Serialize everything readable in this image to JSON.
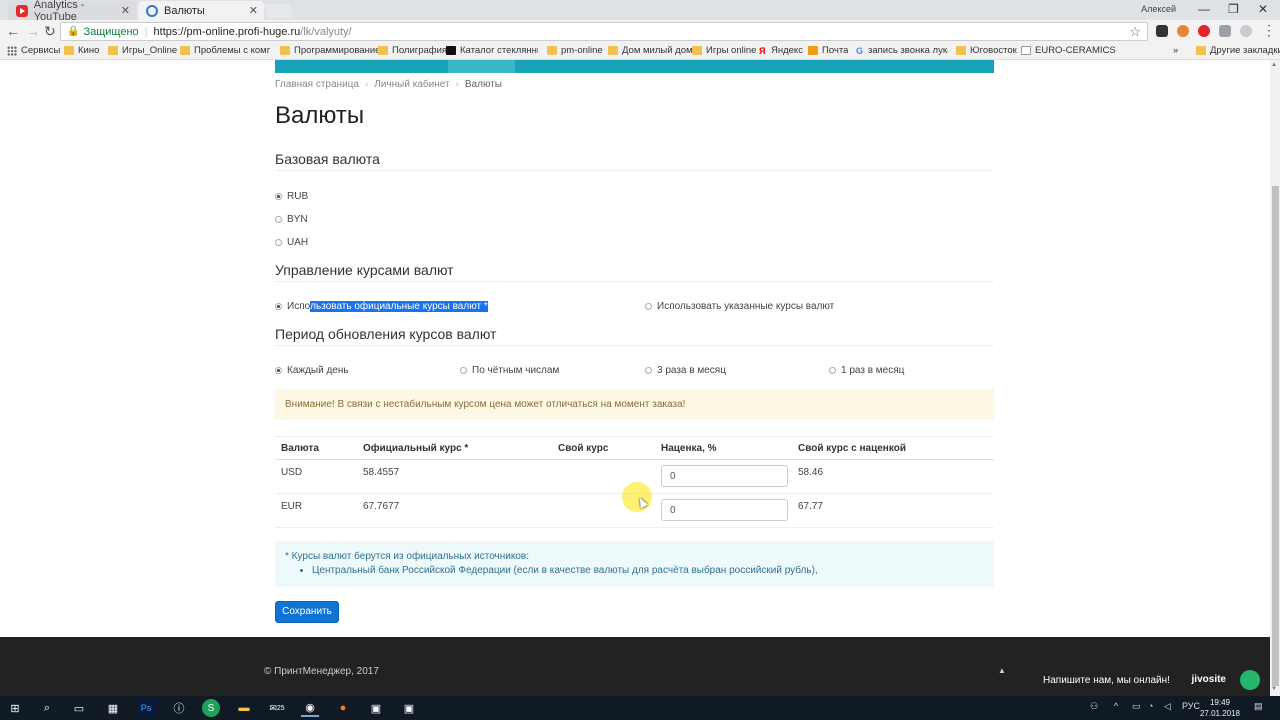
{
  "browser": {
    "tabs": [
      {
        "title": "Analytics - YouTube",
        "icon": "youtube-icon"
      },
      {
        "title": "Валюты",
        "icon": "globe-icon"
      }
    ],
    "user": "Алексей",
    "secure_label": "Защищено",
    "url_host": "https://pm-online.profi-huge.ru",
    "url_path": "/lk/valyuty/",
    "bookmarks": [
      "Сервисы",
      "Кино",
      "Игры_Online",
      "Проблемы с компо",
      "Программирование",
      "Полиграфия",
      "Каталог стеклянных",
      "pm-online",
      "Дом милый дом",
      "Игры online",
      "Яндекс",
      "Почта",
      "запись звонка лука",
      "Юговосток",
      "EURO-CERAMICS"
    ],
    "other_bookmarks": "Другие закладки",
    "more": "»"
  },
  "page": {
    "breadcrumb": [
      "Главная страница",
      "Личный кабинет",
      "Валюты"
    ],
    "title": "Валюты",
    "base_currency": {
      "title": "Базовая валюта",
      "options": [
        "RUB",
        "BYN",
        "UAH"
      ],
      "selected": "RUB"
    },
    "rates_management": {
      "title": "Управление курсами валют",
      "option_official_prefix": "Испо",
      "option_official_selected": "льзовать официальные курсы валют *",
      "option_custom": "Использовать указанные курсы валют"
    },
    "update_period": {
      "title": "Период обновления курсов валют",
      "options": [
        "Каждый день",
        "По чётным числам",
        "3 раза в месяц",
        "1 раз в месяц"
      ],
      "selected": "Каждый день"
    },
    "warning": "Внимание! В связи с нестабильным курсом цена может отличаться на момент заказа!",
    "table": {
      "headers": [
        "Валюта",
        "Официальный курс *",
        "Свой курс",
        "Наценка, %",
        "Свой курс с наценкой"
      ],
      "rows": [
        {
          "currency": "USD",
          "official": "58.4557",
          "custom": "",
          "markup": "0",
          "custom_with_markup": "58.46"
        },
        {
          "currency": "EUR",
          "official": "67.7677",
          "custom": "",
          "markup": "0",
          "custom_with_markup": "67.77"
        }
      ]
    },
    "info": {
      "note": "* Курсы валют берутся из официальных источников:",
      "sources": [
        "Центральный банк Российской Федерации (если в качестве валюты для расчёта выбран российский рубль),"
      ]
    },
    "save_label": "Сохранить",
    "footer": "© ПринтМенеджер, 2017",
    "chat": {
      "label": "Напишите нам, мы онлайн!",
      "brand": "jivosite"
    }
  },
  "taskbar": {
    "language": "РУС",
    "time": "19:49",
    "date": "27.01.2018",
    "badge": "25"
  },
  "colors": {
    "accent": "#17a2b8",
    "button": "#0f74d4",
    "warning_bg": "#fcf8e3",
    "info_bg": "#eef9fc",
    "footer_bg": "#222222"
  }
}
